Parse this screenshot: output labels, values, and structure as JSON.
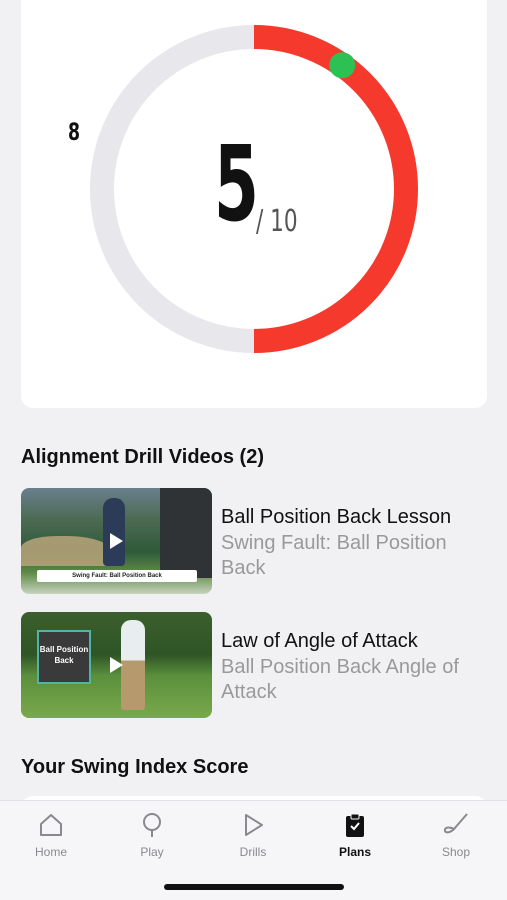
{
  "score": {
    "value": "5",
    "max": "/ 10",
    "marker_label": "8",
    "fraction": 0.5,
    "colors": {
      "fill": "#f5392c",
      "track": "#e7e7ec",
      "marker": "#2cc152"
    }
  },
  "drills": {
    "title": "Alignment Drill Videos (2)",
    "videos": [
      {
        "title": "Ball Position Back Lesson",
        "subtitle": "Swing Fault: Ball Position Back",
        "thumb_caption": "Swing Fault: Ball Position Back"
      },
      {
        "title": "Law of Angle of Attack",
        "subtitle": "Ball Position Back Angle of Attack",
        "thumb_caption": "Ball Position Back"
      }
    ]
  },
  "swing_index": {
    "title": "Your Swing Index Score"
  },
  "tabbar": {
    "tabs": [
      {
        "label": "Home",
        "icon": "home-icon"
      },
      {
        "label": "Play",
        "icon": "pin-icon"
      },
      {
        "label": "Drills",
        "icon": "play-icon"
      },
      {
        "label": "Plans",
        "icon": "clipboard-icon",
        "active": true
      },
      {
        "label": "Shop",
        "icon": "golf-club-icon"
      }
    ]
  }
}
